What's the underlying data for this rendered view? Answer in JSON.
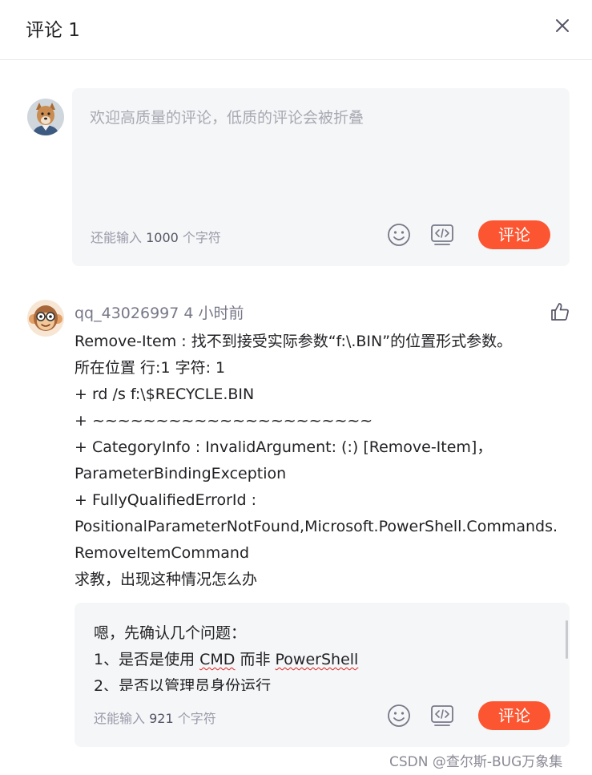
{
  "header": {
    "title": "评论 1"
  },
  "composer": {
    "placeholder": "欢迎高质量的评论，低质的评论会被折叠",
    "hint_prefix": "还能输入 ",
    "hint_count": "1000",
    "hint_suffix": " 个字符",
    "submit_label": "评论"
  },
  "comment": {
    "username": "qq_43026997",
    "time": "4 小时前",
    "lines": [
      "Remove-Item : 找不到接受实际参数“f:\\.BIN”的位置形式参数。",
      "所在位置 行:1 字符: 1",
      "+ rd /s f:\\$RECYCLE.BIN",
      "+ ~~~~~~~~~~~~~~~~~~~~~~",
      "+ CategoryInfo : InvalidArgument: (:) [Remove-Item]，",
      "ParameterBindingException",
      "+ FullyQualifiedErrorId :",
      "PositionalParameterNotFound,Microsoft.PowerShell.Commands.",
      "RemoveItemCommand",
      "求教，出现这种情况怎么办"
    ]
  },
  "reply": {
    "line1": "嗯，先确认几个问题：",
    "line2_a": "1、是否是使用 ",
    "line2_cmd": "CMD",
    "line2_b": " 而非 ",
    "line2_ps": "PowerShell",
    "line3": "2、是否以管理员身份运行",
    "hint_prefix": "还能输入 ",
    "hint_count": "921",
    "hint_suffix": " 个字符",
    "submit_label": "评论"
  },
  "watermark": "CSDN @查尔斯-BUG万象集",
  "colors": {
    "accent": "#fc5531",
    "panel_bg": "#f5f6f7",
    "muted_text": "#999aaa"
  }
}
